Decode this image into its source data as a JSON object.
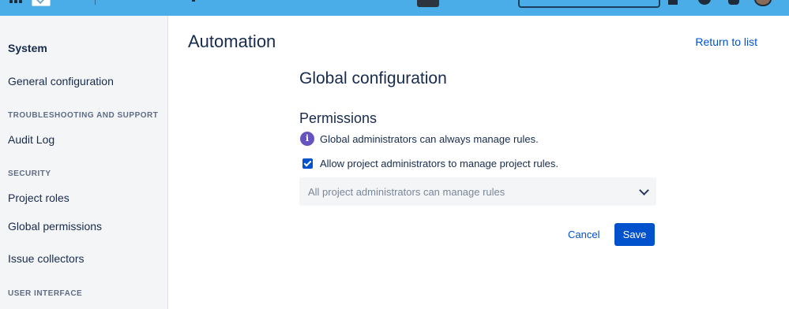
{
  "topbar": {
    "icons": [
      "apps-icon",
      "logo-icon",
      "bell-icon",
      "help-icon",
      "gear-icon",
      "avatar"
    ]
  },
  "sidebar": {
    "title": "System",
    "general": "General configuration",
    "troubleshooting_header": "TROUBLESHOOTING AND SUPPORT",
    "audit_log": "Audit Log",
    "security_header": "SECURITY",
    "project_roles": "Project roles",
    "global_permissions": "Global permissions",
    "issue_collectors": "Issue collectors",
    "ui_header": "USER INTERFACE"
  },
  "main": {
    "title": "Automation",
    "return_link": "Return to list",
    "section_title": "Global configuration",
    "permissions_title": "Permissions",
    "info_icon_glyph": "i",
    "info_text": "Global administrators can always manage rules.",
    "checkbox_checked": true,
    "checkbox_label": "Allow project administrators to manage project rules.",
    "select_value": "All project administrators can manage rules",
    "cancel_label": "Cancel",
    "save_label": "Save"
  },
  "colors": {
    "topbar": "#4bade8",
    "primary": "#0052cc",
    "info": "#6554c0",
    "sidebar_bg": "#f4f5f7"
  }
}
